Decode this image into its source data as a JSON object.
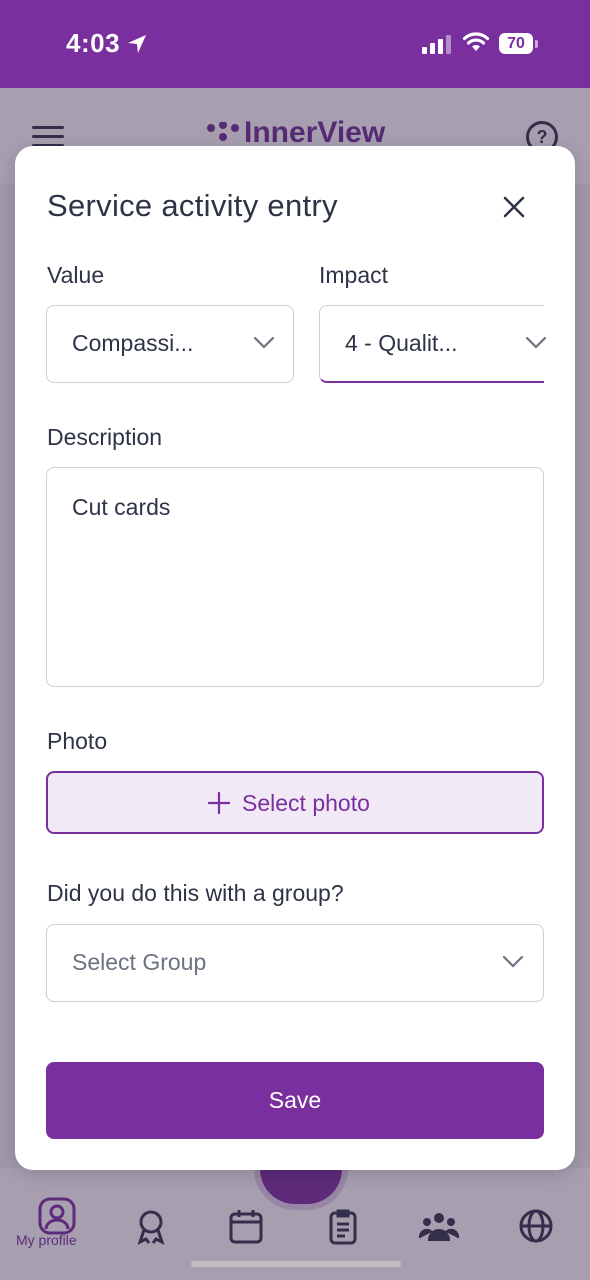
{
  "status_bar": {
    "time": "4:03",
    "battery": "70"
  },
  "app": {
    "brand": "InnerView",
    "nav_profile_label": "My profile"
  },
  "modal": {
    "title": "Service activity entry",
    "value": {
      "label": "Value",
      "selected": "Compassi..."
    },
    "impact": {
      "label": "Impact",
      "selected": "4 - Qualit..."
    },
    "description": {
      "label": "Description",
      "text": "Cut cards"
    },
    "photo": {
      "label": "Photo",
      "button": "Select photo"
    },
    "group": {
      "label": "Did you do this with a group?",
      "placeholder": "Select Group"
    },
    "save": "Save"
  },
  "colors": {
    "accent": "#7a2f9e",
    "text": "#2d3446",
    "border": "#c9d0dc",
    "photo_bg": "#f2e9f6"
  }
}
